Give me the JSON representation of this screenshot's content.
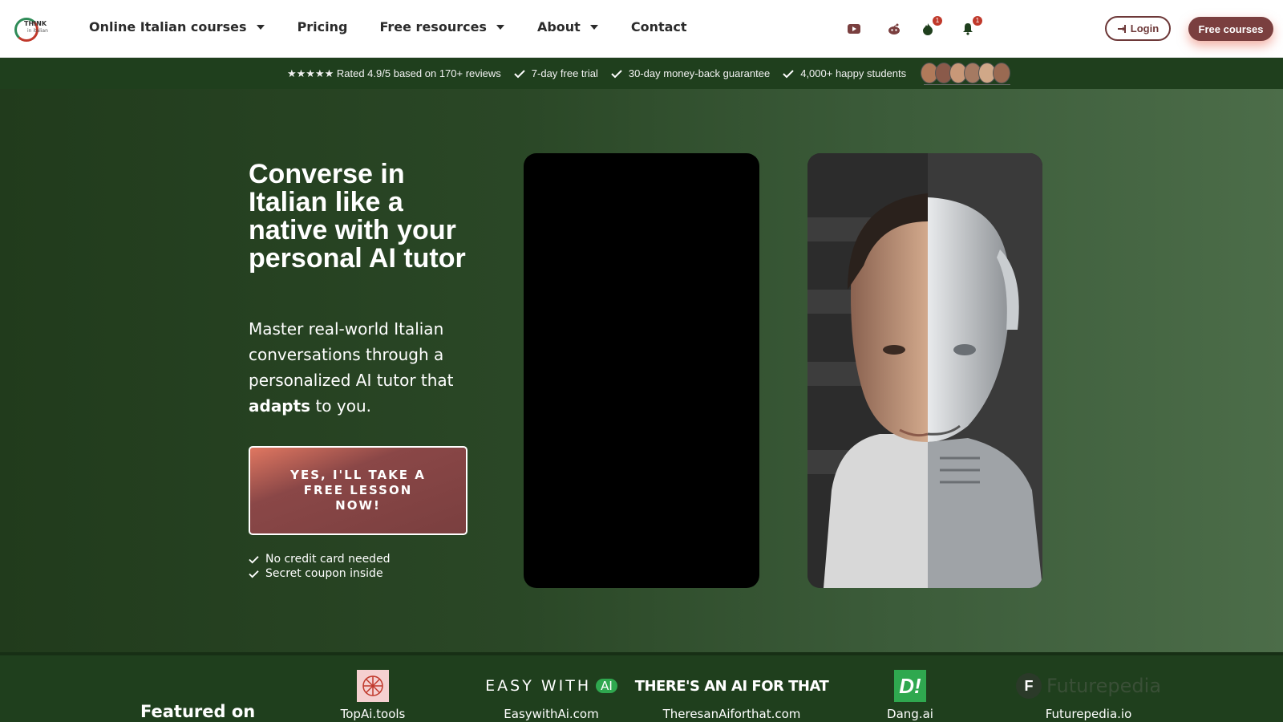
{
  "brand": {
    "logo_text": "THINK",
    "logo_sub": "in italian"
  },
  "nav": {
    "items": [
      {
        "label": "Online Italian courses",
        "dropdown": true
      },
      {
        "label": "Pricing",
        "dropdown": false
      },
      {
        "label": "Free resources",
        "dropdown": true
      },
      {
        "label": "About",
        "dropdown": true
      },
      {
        "label": "Contact",
        "dropdown": false
      }
    ]
  },
  "header_icons": {
    "youtube_icon": "youtube-icon",
    "reddit_icon": "reddit-icon",
    "fire_icon": "fire-icon",
    "fire_badge": "1",
    "bell_icon": "bell-icon",
    "bell_badge": "1"
  },
  "buttons": {
    "login": "Login",
    "free_courses": "Free courses"
  },
  "trust": {
    "rating": "★★★★★ Rated 4.9/5 based on 170+ reviews",
    "items": [
      "7-day free trial",
      "30-day money-back guarantee",
      "4,000+ happy students"
    ]
  },
  "hero": {
    "title": "Converse in Italian like a native with your personal AI tutor",
    "subtitle_pre": "Master real-world Italian conversations through a personalized AI tutor that ",
    "subtitle_bold": "adapts",
    "subtitle_post": " to you.",
    "cta": "YES, I'LL TAKE A FREE LESSON NOW!",
    "perks": [
      "No credit card needed",
      "Secret coupon inside"
    ]
  },
  "featured": {
    "title": "Featured on",
    "items": [
      {
        "caption": "TopAi.tools"
      },
      {
        "caption": "EasywithAi.com",
        "logo": "EASY WITH",
        "logo_badge": "AI"
      },
      {
        "caption": "TheresanAiforthat.com",
        "logo": "THERE'S AN AI FOR THAT"
      },
      {
        "caption": "Dang.ai",
        "logo": "D!"
      },
      {
        "caption": "Futurepedia.io",
        "logo": "Futurepedia"
      }
    ]
  },
  "colors": {
    "brand_dark_green": "#1f3f1d",
    "accent_maroon": "#7a3f3f",
    "accent_coral": "#e07761"
  }
}
